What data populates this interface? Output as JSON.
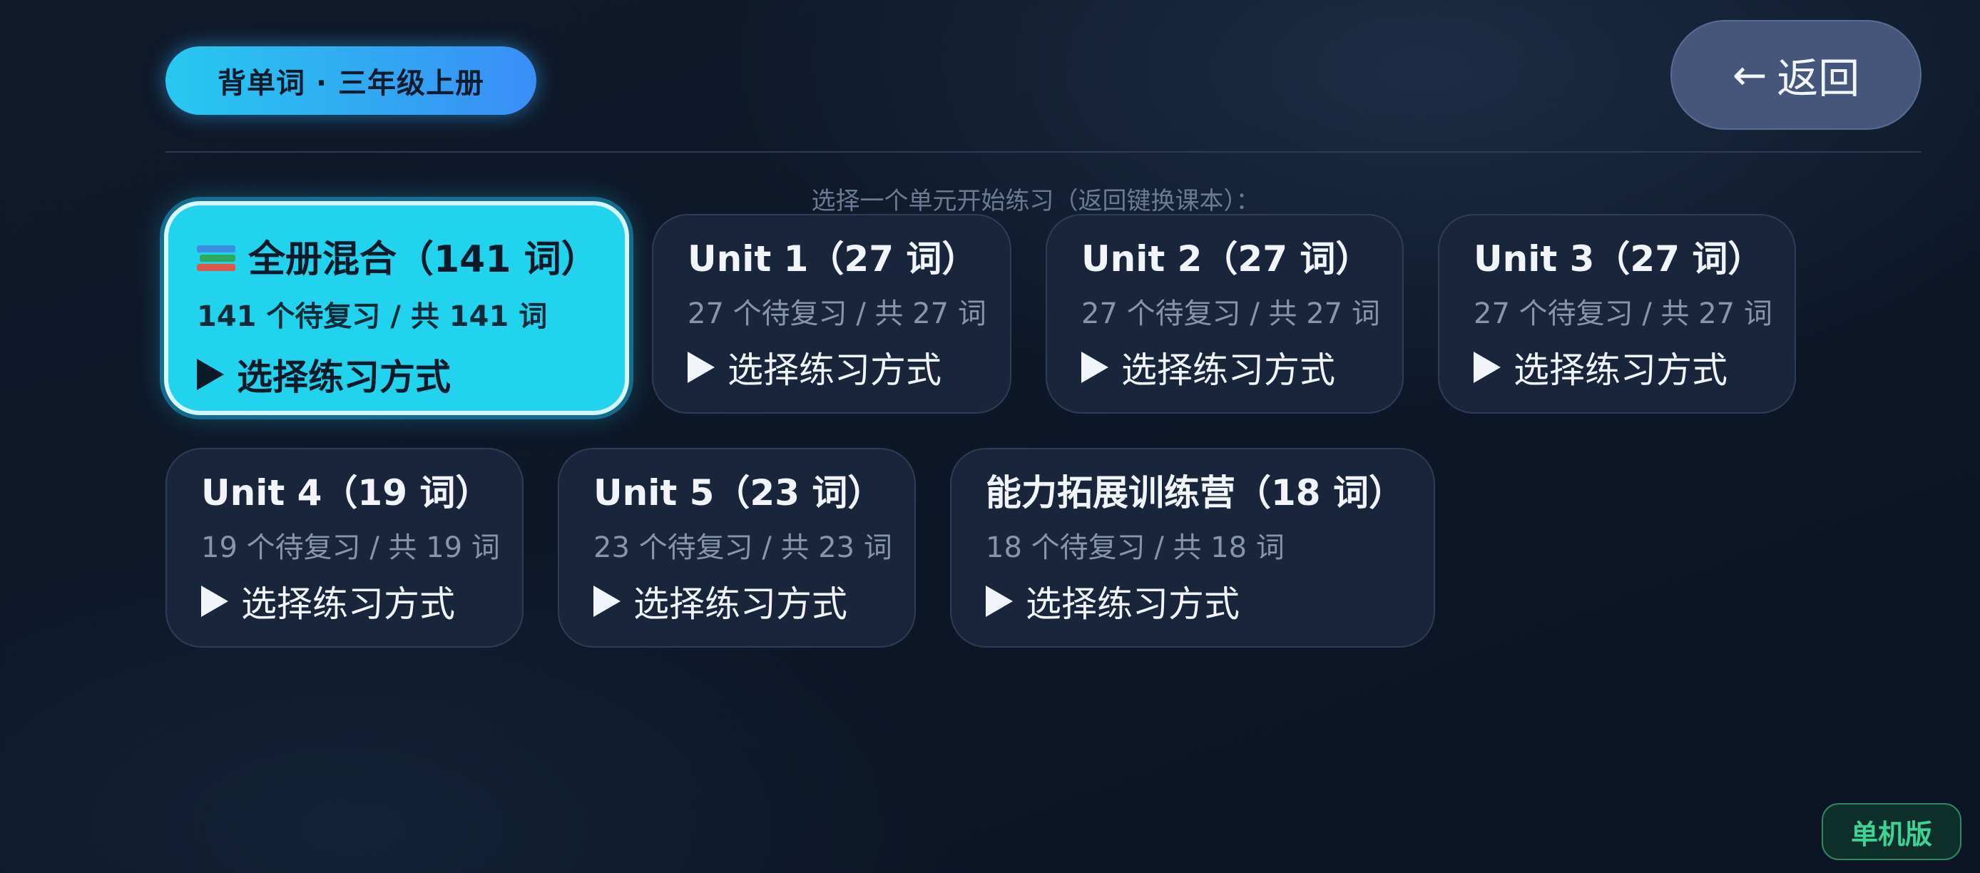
{
  "header": {
    "title": "背单词 · 三年级上册",
    "back_arrow": "←",
    "back_label": "返回"
  },
  "hint": "选择一个单元开始练习（返回键换课本）：",
  "action_label": "选择练习方式",
  "units": [
    {
      "title": "全册混合（141 词）",
      "sub": "141 个待复习 / 共 141 词",
      "icon": "books-icon",
      "selected": true
    },
    {
      "title": "Unit 1（27 词）",
      "sub": "27 个待复习 / 共 27 词"
    },
    {
      "title": "Unit 2（27 词）",
      "sub": "27 个待复习 / 共 27 词"
    },
    {
      "title": "Unit 3（27 词）",
      "sub": "27 个待复习 / 共 27 词"
    },
    {
      "title": "Unit 4（19 词）",
      "sub": "19 个待复习 / 共 19 词"
    },
    {
      "title": "Unit 5（23 词）",
      "sub": "23 个待复习 / 共 23 词"
    },
    {
      "title": "能力拓展训练营（18 词）",
      "sub": "18 个待复习 / 共 18 词"
    }
  ],
  "badge": "单机版",
  "colors": {
    "accent": "#22d3ed",
    "card_bg": "#19253a",
    "badge_green": "#3ed293"
  }
}
